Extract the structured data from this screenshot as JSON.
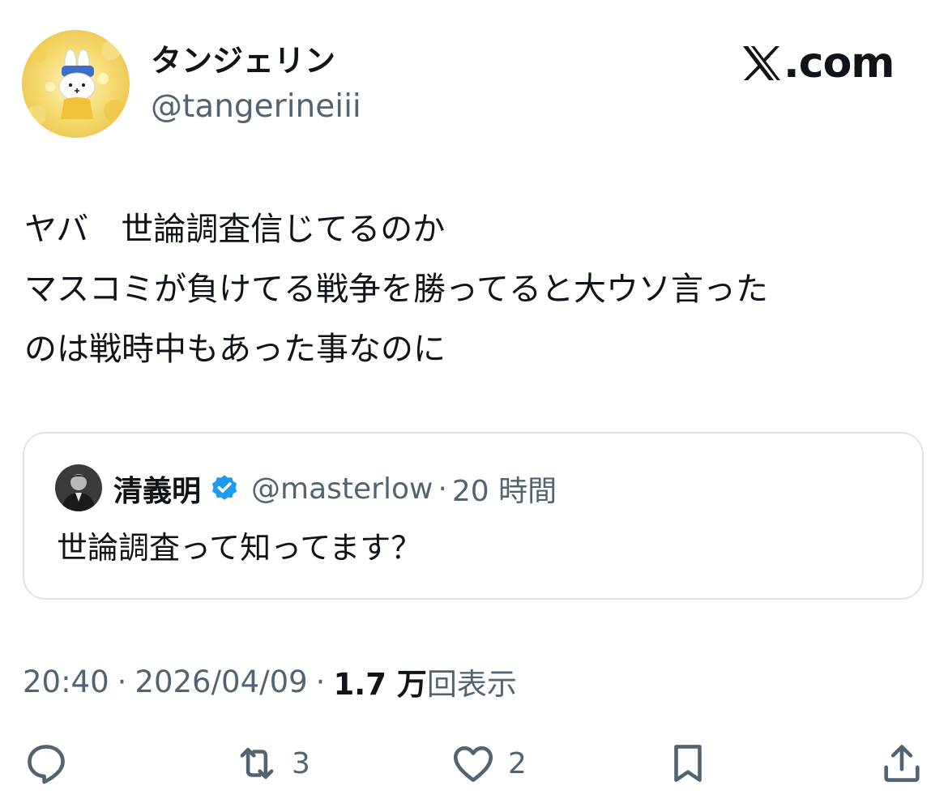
{
  "author": {
    "display_name": "タンジェリン",
    "handle": "@tangerineiii",
    "avatar_icon": "avatar-image"
  },
  "brand": {
    "text": ".com",
    "logo_icon": "x-logo-icon"
  },
  "tweet": {
    "lines": [
      "ヤバ　世論調査信じてるのか",
      "マスコミが負けてる戦争を勝ってると大ウソ言った",
      "のは戦時中もあった事なのに"
    ]
  },
  "quote": {
    "name": "清義明",
    "handle": "@masterlow",
    "separator": "·",
    "time": "20 時間",
    "text": "世論調査って知ってます？",
    "verified_color": "#1d9bf0"
  },
  "meta": {
    "time": "20:40",
    "separator": "·",
    "date": "2026/04/09",
    "views_count": "1.7 万",
    "views_label": "回表示"
  },
  "actions": {
    "reply": {
      "icon": "reply-icon"
    },
    "retweet": {
      "icon": "retweet-icon",
      "count": "3"
    },
    "like": {
      "icon": "heart-icon",
      "count": "2"
    },
    "bookmark": {
      "icon": "bookmark-icon"
    },
    "share": {
      "icon": "share-icon"
    }
  },
  "colors": {
    "text_primary": "#0f1419",
    "text_secondary": "#536471",
    "border": "#dfe4e8",
    "verified": "#1d9bf0"
  }
}
